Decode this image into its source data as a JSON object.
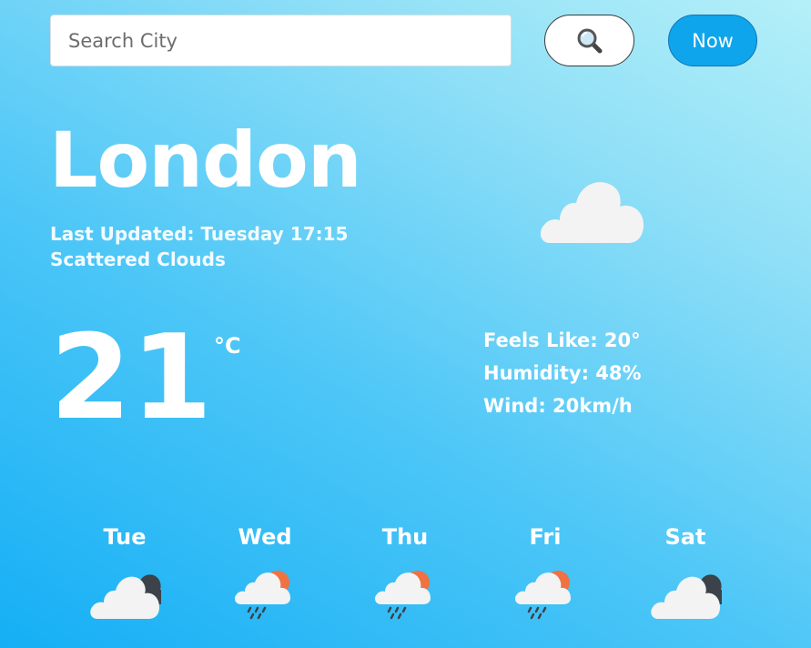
{
  "search": {
    "placeholder": "Search City",
    "button_icon": "magnifying-glass-icon"
  },
  "now_button": {
    "label": "Now"
  },
  "current": {
    "city": "London",
    "last_updated": "Last Updated: Tuesday 17:15",
    "description": "Scattered Clouds",
    "icon": "cloud-icon",
    "temperature": "21",
    "unit": "°C",
    "feels_like": "Feels Like: 20°",
    "humidity": "Humidity: 48%",
    "wind": "Wind: 20km/h"
  },
  "forecast": [
    {
      "day": "Tue",
      "icon": "broken-clouds-icon"
    },
    {
      "day": "Wed",
      "icon": "sun-rain-cloud-icon"
    },
    {
      "day": "Thu",
      "icon": "sun-rain-cloud-icon"
    },
    {
      "day": "Fri",
      "icon": "sun-rain-cloud-icon"
    },
    {
      "day": "Sat",
      "icon": "broken-clouds-icon"
    }
  ],
  "colors": {
    "accent": "#0ea5ec",
    "sun": "#f07142",
    "dark_cloud": "#3b4249",
    "light_cloud": "#f2f2f2"
  }
}
